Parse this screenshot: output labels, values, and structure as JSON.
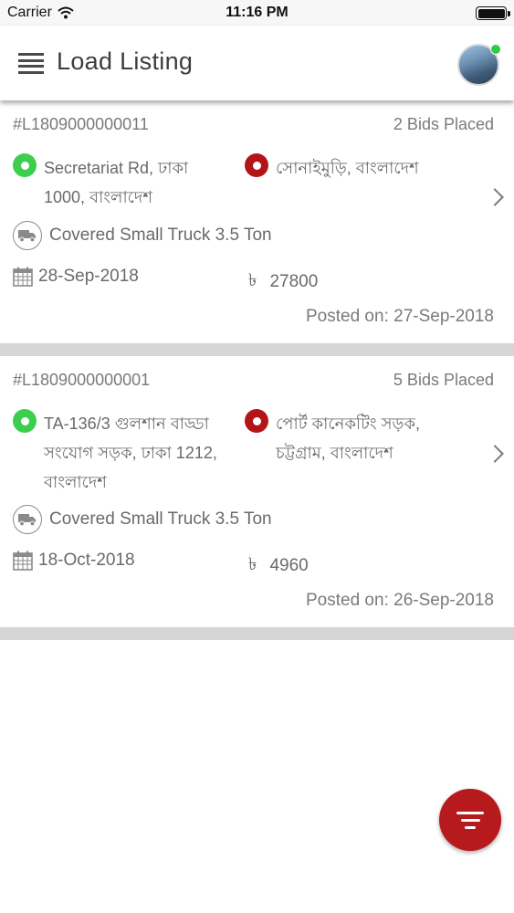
{
  "status_bar": {
    "carrier": "Carrier",
    "time": "11:16 PM"
  },
  "header": {
    "title": "Load Listing"
  },
  "loads": [
    {
      "id": "#L1809000000011",
      "bids": "2 Bids Placed",
      "from_lines": [
        "Secretariat Rd, ঢাকা",
        "1000, বাংলাদেশ"
      ],
      "to_lines": [
        "সোনাইমুড়ি, বাংলাদেশ"
      ],
      "vehicle": "Covered Small Truck 3.5 Ton",
      "date": "28-Sep-2018",
      "currency": "৳",
      "price": "27800",
      "posted": "Posted on: 27-Sep-2018"
    },
    {
      "id": "#L1809000000001",
      "bids": "5 Bids Placed",
      "from_lines": [
        "TA-136/3 গুলশান বাড্ডা",
        "সংযোগ সড়ক, ঢাকা 1212,",
        "বাংলাদেশ"
      ],
      "to_lines": [
        "পোর্ট কানেকটিং সড়ক,",
        "চট্টগ্রাম, বাংলাদেশ"
      ],
      "vehicle": "Covered Small Truck 3.5 Ton",
      "date": "18-Oct-2018",
      "currency": "৳",
      "price": "4960",
      "posted": "Posted on: 26-Sep-2018"
    }
  ],
  "icons": {
    "menu": "hamburger-icon",
    "from_pin": "map-pin-green-icon",
    "to_pin": "map-pin-red-icon",
    "vehicle": "truck-icon",
    "date": "calendar-icon",
    "open": "chevron-right-icon",
    "filter": "filter-icon"
  },
  "colors": {
    "accent_red": "#b71a1c",
    "pin_green": "#3ccf4e",
    "pin_red": "#b31418",
    "online_dot": "#2ecc40",
    "separator": "#d6d6d6"
  }
}
